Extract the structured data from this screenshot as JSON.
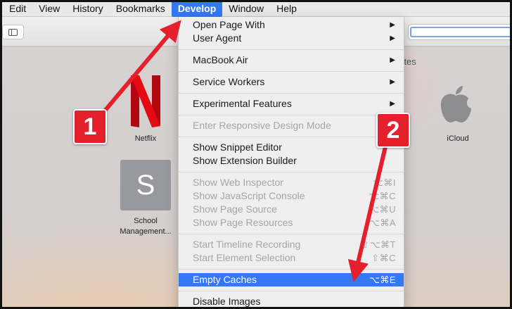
{
  "menubar": {
    "items": [
      "Edit",
      "View",
      "History",
      "Bookmarks",
      "Develop",
      "Window",
      "Help"
    ],
    "active": "Develop"
  },
  "start_page": {
    "favourites_heading": "urites",
    "tiles": [
      {
        "label": "Netflix",
        "icon": "netflix-logo"
      },
      {
        "label": "iCloud",
        "icon": "apple-logo"
      },
      {
        "letter": "S",
        "label_line1": "School",
        "label_line2": "Management..."
      }
    ]
  },
  "develop_menu": {
    "open_page_with": "Open Page With",
    "user_agent": "User Agent",
    "macbook_air": "MacBook Air",
    "service_workers": "Service Workers",
    "experimental_features": "Experimental Features",
    "responsive_design": "Enter Responsive Design Mode",
    "snippet_editor": "Show Snippet Editor",
    "extension_builder": "Show Extension Builder",
    "web_inspector": "Show Web Inspector",
    "web_inspector_sc": "⌥⌘I",
    "js_console": "Show JavaScript Console",
    "js_console_sc": "⌥⌘C",
    "page_source": "Show Page Source",
    "page_source_sc": "⌥⌘U",
    "page_resources": "Show Page Resources",
    "page_resources_sc": "⌥⌘A",
    "timeline": "Start Timeline Recording",
    "timeline_sc": "⇧⌥⌘T",
    "element_selection": "Start Element Selection",
    "element_selection_sc": "⇧⌘C",
    "empty_caches": "Empty Caches",
    "empty_caches_sc": "⌥⌘E",
    "disable_images": "Disable Images",
    "submenu_arrow": "▶"
  },
  "annotations": {
    "step1": "1",
    "step2": "2",
    "arrow_color": "#e3202c"
  }
}
